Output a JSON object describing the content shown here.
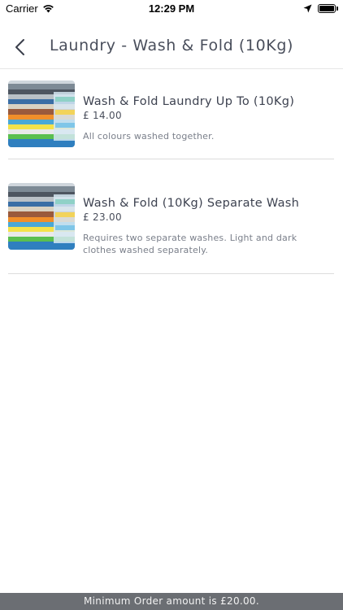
{
  "status_bar": {
    "carrier": "Carrier",
    "time": "12:29 PM",
    "icons": [
      "wifi-icon",
      "location-icon",
      "battery-icon"
    ]
  },
  "nav": {
    "back_icon": "chevron-left-icon",
    "title": "Laundry - Wash & Fold (10Kg)"
  },
  "products": [
    {
      "name": "Wash & Fold Laundry Up To (10Kg)",
      "price": "£ 14.00",
      "description": "All colours washed together.",
      "image": "folded-clothes-stack"
    },
    {
      "name": "Wash & Fold (10Kg) Separate Wash",
      "price": "£ 23.00",
      "description": "Requires two separate washes. Light and dark clothes washed separately.",
      "image": "folded-clothes-stack"
    }
  ],
  "footer": {
    "message": "Minimum Order amount is £20.00."
  },
  "colors": {
    "footer_bg": "#6b6e73",
    "divider": "#dcdcdc",
    "title_text": "#4a4f5c"
  }
}
